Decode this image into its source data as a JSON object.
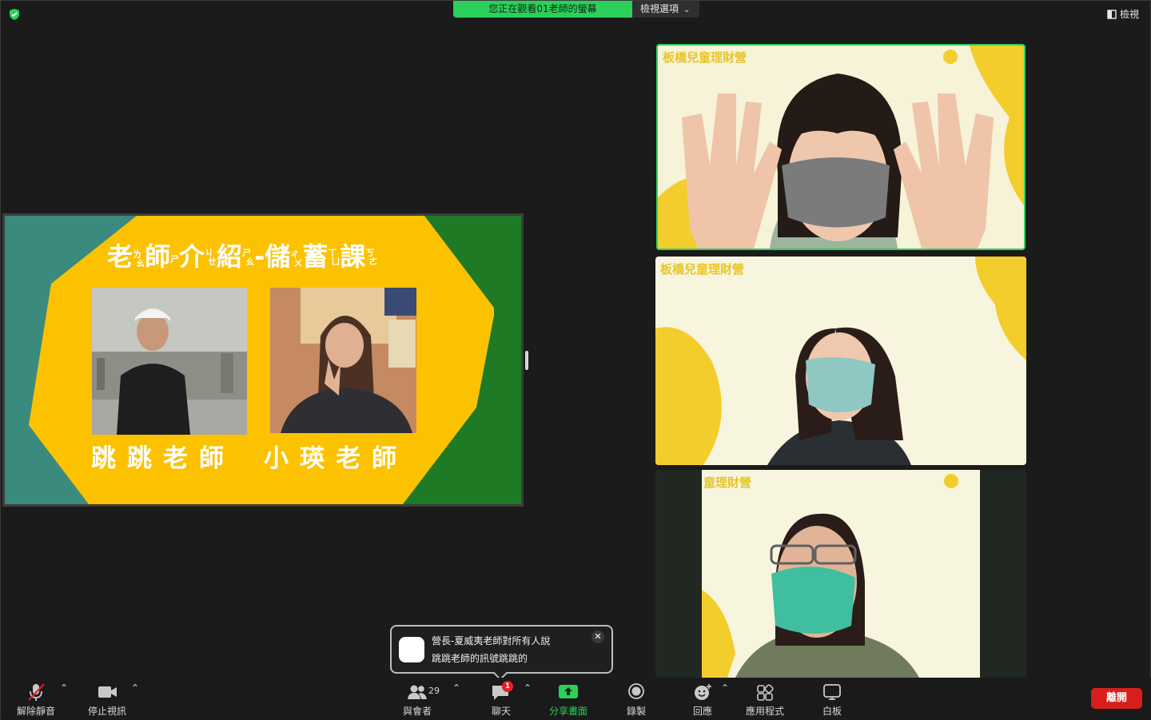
{
  "banner": {
    "text": "您正在觀看01老師的螢幕",
    "view_options": "檢視選項"
  },
  "top_right": {
    "view_label": "檢視"
  },
  "slide": {
    "title": "老ㄌㄠˇ師ㄕ介ㄐㄧㄝˋ紹ㄕㄠˋ-儲ㄔㄨˇ蓄ㄒㄩˋ課ㄎㄜˋ",
    "title_main": [
      "老",
      "師",
      "介",
      "紹",
      "-",
      "儲",
      "蓄",
      "課"
    ],
    "teacher1": "跳跳老師",
    "teacher2": "小瑛老師",
    "colors": {
      "teal": "#3b8a7e",
      "yellow": "#fcc200",
      "green": "#1e7a24"
    }
  },
  "videos": [
    {
      "watermark": "板橋兒童理財營",
      "active": true
    },
    {
      "watermark": "板橋兒童理財營",
      "active": false
    },
    {
      "watermark": "童理財營",
      "active": false
    }
  ],
  "toast": {
    "line1": "營長-夏威夷老師對所有人說",
    "line2": "跳跳老師的訊號跳跳的",
    "close": "✕"
  },
  "toolbar": {
    "unmute": "解除靜音",
    "stop_video": "停止視訊",
    "participants": "與會者",
    "participants_count": "29",
    "chat": "聊天",
    "chat_badge": "1",
    "share": "分享畫面",
    "record": "錄製",
    "reactions": "回應",
    "apps": "應用程式",
    "whiteboard": "白板",
    "leave": "離開"
  }
}
